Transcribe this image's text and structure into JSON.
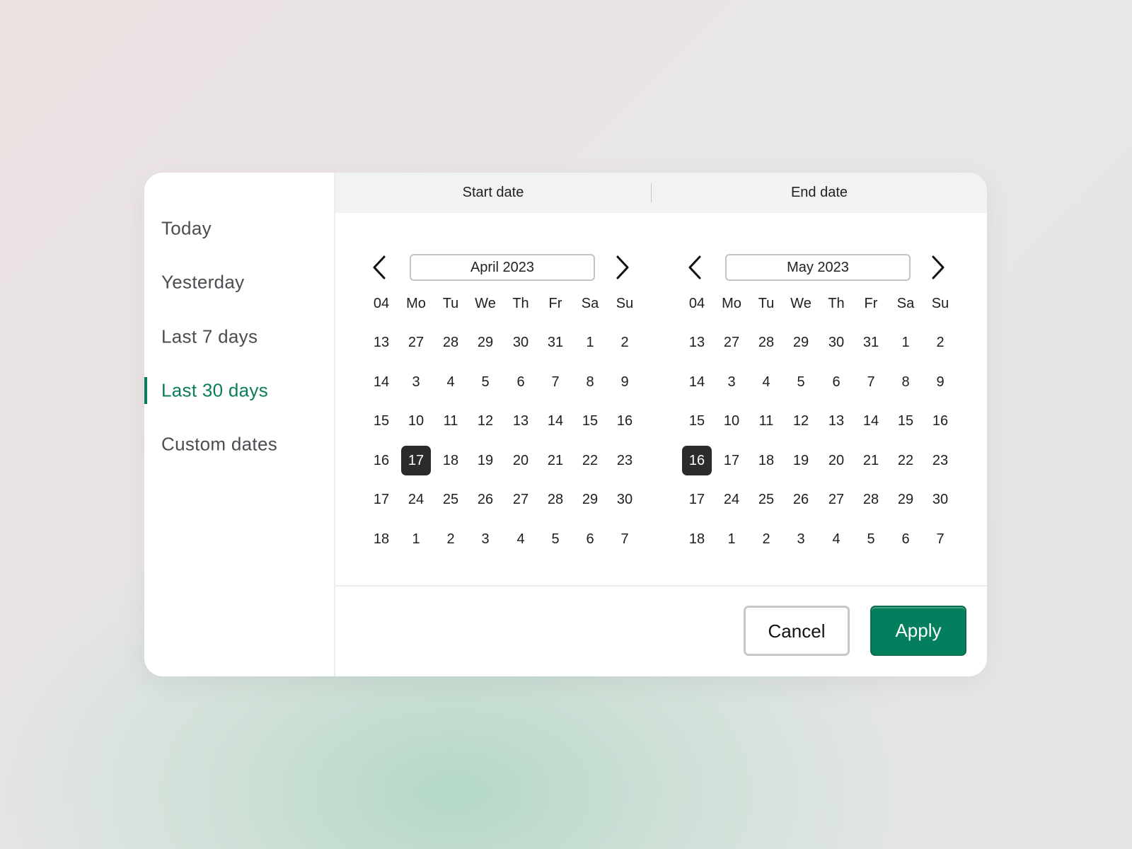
{
  "sidebar": {
    "active_index": 3,
    "items": [
      {
        "label": "Today"
      },
      {
        "label": "Yesterday"
      },
      {
        "label": "Last 7 days"
      },
      {
        "label": "Last 30 days"
      },
      {
        "label": "Custom dates"
      }
    ]
  },
  "header": {
    "start_label": "Start date",
    "end_label": "End date"
  },
  "calendars": [
    {
      "month_label": "April 2023",
      "headers": [
        "04",
        "Mo",
        "Tu",
        "We",
        "Th",
        "Fr",
        "Sa",
        "Su"
      ],
      "weeks": [
        {
          "week": "13",
          "days": [
            "27",
            "28",
            "29",
            "30",
            "31",
            "1",
            "2"
          ]
        },
        {
          "week": "14",
          "days": [
            "3",
            "4",
            "5",
            "6",
            "7",
            "8",
            "9"
          ]
        },
        {
          "week": "15",
          "days": [
            "10",
            "11",
            "12",
            "13",
            "14",
            "15",
            "16"
          ]
        },
        {
          "week": "16",
          "days": [
            "17",
            "18",
            "19",
            "20",
            "21",
            "22",
            "23"
          ]
        },
        {
          "week": "17",
          "days": [
            "24",
            "25",
            "26",
            "27",
            "28",
            "29",
            "30"
          ]
        },
        {
          "week": "18",
          "days": [
            "1",
            "2",
            "3",
            "4",
            "5",
            "6",
            "7"
          ]
        }
      ],
      "selected": {
        "week_index": 3,
        "day_index": 0
      }
    },
    {
      "month_label": "May 2023",
      "headers": [
        "04",
        "Mo",
        "Tu",
        "We",
        "Th",
        "Fr",
        "Sa",
        "Su"
      ],
      "weeks": [
        {
          "week": "13",
          "days": [
            "27",
            "28",
            "29",
            "30",
            "31",
            "1",
            "2"
          ]
        },
        {
          "week": "14",
          "days": [
            "3",
            "4",
            "5",
            "6",
            "7",
            "8",
            "9"
          ]
        },
        {
          "week": "15",
          "days": [
            "10",
            "11",
            "12",
            "13",
            "14",
            "15",
            "16"
          ]
        },
        {
          "week": "16",
          "days": [
            "17",
            "18",
            "19",
            "20",
            "21",
            "22",
            "23"
          ]
        },
        {
          "week": "17",
          "days": [
            "24",
            "25",
            "26",
            "27",
            "28",
            "29",
            "30"
          ]
        },
        {
          "week": "18",
          "days": [
            "1",
            "2",
            "3",
            "4",
            "5",
            "6",
            "7"
          ]
        }
      ],
      "selected": {
        "week_index": 3,
        "day_index": -1
      }
    }
  ],
  "footer": {
    "cancel_label": "Cancel",
    "apply_label": "Apply"
  },
  "colors": {
    "accent": "#047f5d",
    "selected_day_bg": "#2b2b2b"
  },
  "icons": {
    "prev": "chevron-left-icon",
    "next": "chevron-right-icon"
  }
}
